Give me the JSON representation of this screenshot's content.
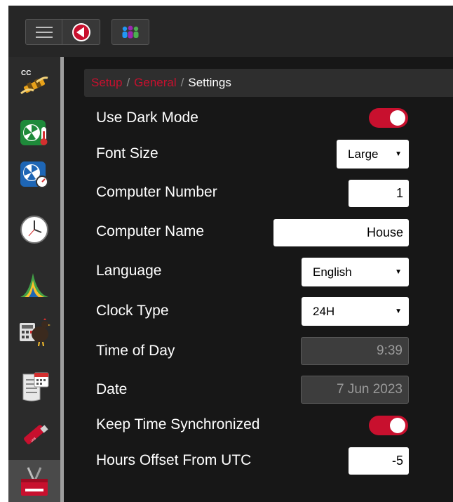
{
  "topbar": {
    "menu_icon": "hamburger-menu-icon",
    "back_icon": "back-arrow-icon",
    "users_icon": "users-icon",
    "accent": "#c8102e"
  },
  "sidebar": {
    "items": [
      {
        "name": "cc-cable",
        "icon": "cc-cable-icon",
        "badge": "CC"
      },
      {
        "name": "climate",
        "icon": "fan-thermometer-icon"
      },
      {
        "name": "ventilation",
        "icon": "fan-gauge-icon"
      },
      {
        "name": "clock",
        "icon": "clock-icon"
      },
      {
        "name": "growth-curve",
        "icon": "curve-chart-icon"
      },
      {
        "name": "flock-calculator",
        "icon": "hen-calculator-icon"
      },
      {
        "name": "history",
        "icon": "calendar-scroll-icon"
      },
      {
        "name": "usb",
        "icon": "usb-drive-icon"
      },
      {
        "name": "setup-tools",
        "icon": "toolbox-icon",
        "active": true
      }
    ]
  },
  "breadcrumb": {
    "items": [
      "Setup",
      "General"
    ],
    "separator": "/",
    "current": "Settings"
  },
  "settings": {
    "dark_mode": {
      "label": "Use Dark Mode",
      "on": true
    },
    "font_size": {
      "label": "Font Size",
      "value": "Large"
    },
    "computer_number": {
      "label": "Computer Number",
      "value": "1"
    },
    "computer_name": {
      "label": "Computer Name",
      "value": "House"
    },
    "language": {
      "label": "Language",
      "value": "English"
    },
    "clock_type": {
      "label": "Clock Type",
      "value": "24H"
    },
    "time_of_day": {
      "label": "Time of Day",
      "value": "9:39"
    },
    "date": {
      "label": "Date",
      "value": "7 Jun 2023"
    },
    "keep_sync": {
      "label": "Keep Time Synchronized",
      "on": true
    },
    "utc_offset": {
      "label": "Hours Offset From UTC",
      "value": "-5"
    }
  },
  "colors": {
    "toggle_on": "#c8102e",
    "background": "#171717",
    "sidebar": "#2b2b2b"
  }
}
